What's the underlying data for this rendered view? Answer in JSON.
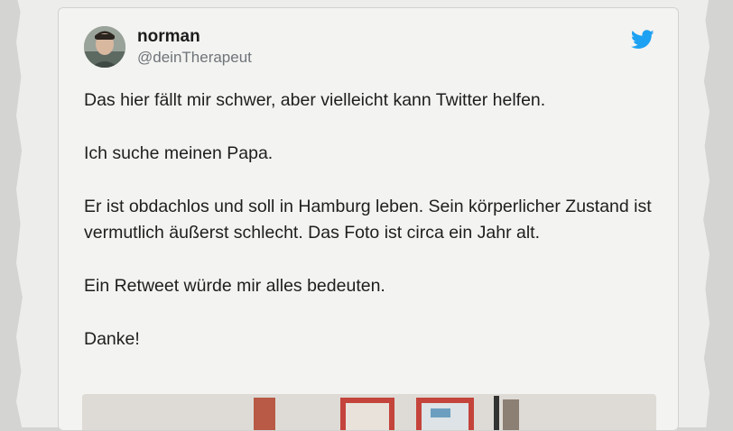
{
  "tweet": {
    "author_name": "norman",
    "author_handle": "@deinTherapeut",
    "paragraphs": [
      "Das hier fällt mir schwer, aber vielleicht kann Twitter helfen.",
      "Ich suche meinen Papa.",
      "Er ist obdachlos und soll in Hamburg leben. Sein körperlicher Zustand ist vermutlich äußerst schlecht. Das Foto ist circa ein Jahr alt.",
      "Ein Retweet würde mir alles bedeuten.",
      "Danke!"
    ]
  },
  "icons": {
    "brand": "twitter-bird-icon",
    "avatar": "profile-photo"
  },
  "colors": {
    "twitter_blue": "#1da1f2",
    "paper": "#ededeb",
    "text": "#1e1e1e",
    "handle": "#6f7479"
  }
}
